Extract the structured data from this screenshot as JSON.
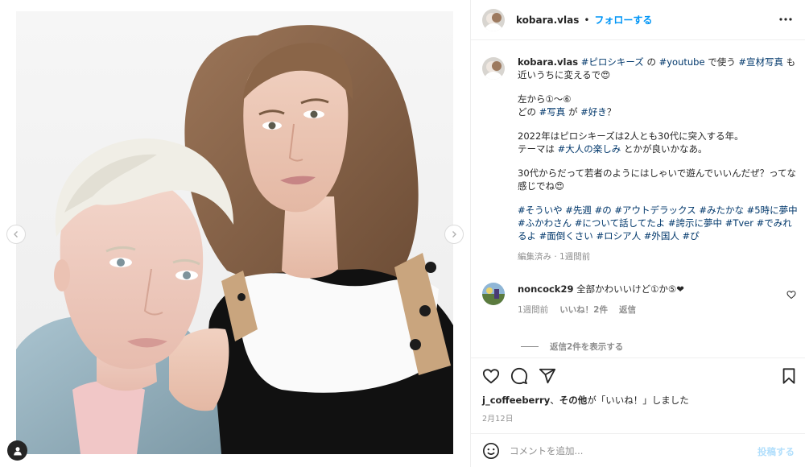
{
  "header": {
    "username": "kobara.vlas",
    "separator": "•",
    "follow_label": "フォローする"
  },
  "caption": {
    "username": "kobara.vlas",
    "line1": [
      {
        "t": "#ピロシキーズ",
        "tag": true
      },
      {
        "t": " の ",
        "tag": false
      },
      {
        "t": "#youtube",
        "tag": true
      },
      {
        "t": " で使う ",
        "tag": false
      },
      {
        "t": "#宣材写真",
        "tag": true
      },
      {
        "t": " も近いうちに変えるで😍",
        "tag": false
      }
    ],
    "para2_a": "左から①〜⑥",
    "para2_b": [
      {
        "t": "どの ",
        "tag": false
      },
      {
        "t": "#写真",
        "tag": true
      },
      {
        "t": " が ",
        "tag": false
      },
      {
        "t": "#好き",
        "tag": true
      },
      {
        "t": "？",
        "tag": false
      }
    ],
    "para3_a": "2022年はピロシキーズは2人とも30代に突入する年。",
    "para3_b": [
      {
        "t": "テーマは ",
        "tag": false
      },
      {
        "t": "#大人の楽しみ",
        "tag": true
      },
      {
        "t": " とかが良いかなあ。",
        "tag": false
      }
    ],
    "para4": "30代からだって若者のようにはしゃいで遊んでいいんだぜ？ってな感じでね😍",
    "hashtags": [
      "#そういや",
      "#先週",
      "#の",
      "#アウトデラックス",
      "#みたかな",
      "#5時に夢中",
      "#ふかわさん",
      "#について話してたよ",
      "#誇示に夢中",
      "#Tver",
      "#でみれるよ",
      "#面倒くさい",
      "#ロシア人",
      "#外国人",
      "#ぴ"
    ],
    "meta": "編集済み · 1週間前"
  },
  "comment": {
    "username": "noncock29",
    "text": " 全部かわいいけど①か⑤❤",
    "time": "1週間前",
    "likes": "いいね！2件",
    "reply": "返信"
  },
  "replies_label": "返信2件を表示する",
  "likes_line": {
    "user": "j_coffeeberry",
    "sep": "、",
    "others": "その他",
    "tail": "が「いいね！」しました"
  },
  "date": "2月12日",
  "composer": {
    "placeholder": "コメントを追加...",
    "post_label": "投稿する"
  },
  "colors": {
    "link_blue": "#0095f6",
    "hashtag": "#00376b",
    "muted": "#8e8e8e",
    "post_disabled": "#b2dffc"
  }
}
